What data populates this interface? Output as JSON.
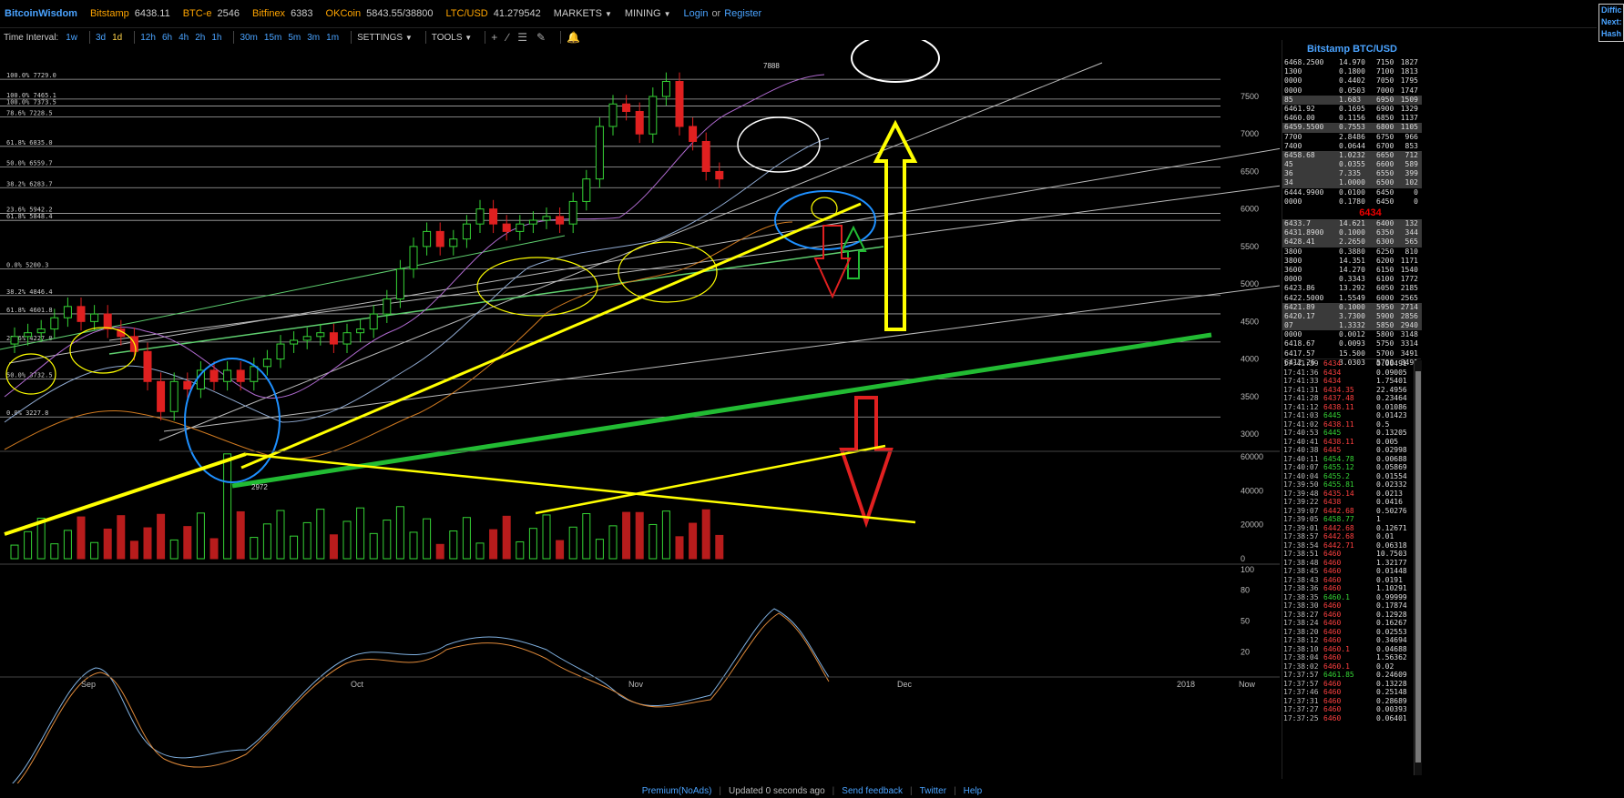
{
  "topbar": {
    "brand": "BitcoinWisdom",
    "tickers": [
      {
        "exchange": "Bitstamp",
        "price": "6438.11"
      },
      {
        "exchange": "BTC-e",
        "price": "2546"
      },
      {
        "exchange": "Bitfinex",
        "price": "6383"
      },
      {
        "exchange": "OKCoin",
        "price": "5843.55/38800"
      },
      {
        "exchange": "LTC/USD",
        "price": "41.279542"
      }
    ],
    "markets_label": "MARKETS",
    "mining_label": "MINING",
    "login_label": "Login",
    "or_label": "or",
    "register_label": "Register",
    "difficulty": [
      "Diffic",
      "Next:",
      "Hash"
    ]
  },
  "toolbar": {
    "time_interval_label": "Time Interval:",
    "intervals": [
      "1w",
      "3d",
      "1d",
      "12h",
      "6h",
      "4h",
      "2h",
      "1h",
      "30m",
      "15m",
      "5m",
      "3m",
      "1m"
    ],
    "settings_label": "SETTINGS",
    "tools_label": "TOOLS"
  },
  "chart_data": {
    "type": "candlestick",
    "series_summary": "BTC/USD daily candles, Sep–Nov 2017",
    "x_ticks": [
      "Sep",
      "Oct",
      "Nov",
      "Dec",
      "2018",
      "Now"
    ],
    "price_axis": [
      3000,
      3500,
      4000,
      4500,
      5000,
      5500,
      6000,
      6500,
      7000,
      7500
    ],
    "volume_axis": [
      0,
      20000,
      40000,
      60000
    ],
    "stoch_axis": [
      20,
      50,
      80,
      100
    ],
    "fib_levels": [
      "100.0% 7729.0",
      "100.0% 7465.1",
      "100.0% 7373.5",
      "78.6% 7228.5",
      "61.8% 6835.0",
      "50.0% 6559.7",
      "38.2% 6283.7",
      "23.6% 5942.2",
      "61.8% 5848.4",
      "0.0% 5200.3",
      "38.2% 4846.4",
      "61.8% 4601.8",
      "23.6% 4227.0",
      "50.0% 3732.5",
      "0.0% 3227.8"
    ],
    "annotations": [
      "7888",
      "2972"
    ],
    "closes": [
      4300,
      4350,
      4400,
      4550,
      4700,
      4500,
      4600,
      4400,
      4300,
      4100,
      3700,
      3300,
      3700,
      3600,
      3850,
      3700,
      3850,
      3700,
      3900,
      4000,
      4200,
      4250,
      4300,
      4350,
      4200,
      4350,
      4400,
      4600,
      4800,
      5200,
      5500,
      5700,
      5500,
      5600,
      5800,
      6000,
      5800,
      5700,
      5800,
      5850,
      5900,
      5800,
      6100,
      6400,
      7100,
      7400,
      7300,
      7000,
      7500,
      7700,
      7100,
      6900,
      6500,
      6400
    ]
  },
  "orderbook": {
    "title": "Bitstamp BTC/USD",
    "asks": [
      [
        "6468.2500",
        "14.970",
        "7150",
        "1827"
      ],
      [
        "1300",
        "0.1800",
        "7100",
        "1813"
      ],
      [
        "0000",
        "0.4402",
        "7050",
        "1795"
      ],
      [
        "0000",
        "0.0503",
        "7000",
        "1747"
      ],
      [
        "85",
        "1.683",
        "6950",
        "1509"
      ],
      [
        "6461.92",
        "0.1695",
        "6900",
        "1329"
      ],
      [
        "6460.00",
        "0.1156",
        "6850",
        "1137"
      ],
      [
        "6459.5500",
        "0.7553",
        "6800",
        "1105"
      ],
      [
        "7700",
        "2.8486",
        "6750",
        "966"
      ],
      [
        "7400",
        "0.0644",
        "6700",
        "853"
      ],
      [
        "6458.68",
        "1.0232",
        "6650",
        "712"
      ],
      [
        "45",
        "0.0355",
        "6600",
        "589"
      ],
      [
        "36",
        "7.335",
        "6550",
        "399"
      ],
      [
        "34",
        "1.0000",
        "6500",
        "102"
      ],
      [
        "6444.9900",
        "0.0100",
        "6450",
        "0"
      ],
      [
        "0000",
        "0.1780",
        "6450",
        "0"
      ]
    ],
    "last_price": "6434",
    "bids": [
      [
        "6433.7",
        "14.621",
        "6400",
        "132"
      ],
      [
        "6431.8900",
        "0.1000",
        "6350",
        "344"
      ],
      [
        "6428.41",
        "2.2650",
        "6300",
        "565"
      ],
      [
        "3800",
        "0.3880",
        "6250",
        "810"
      ],
      [
        "3800",
        "14.351",
        "6200",
        "1171"
      ],
      [
        "3600",
        "14.270",
        "6150",
        "1540"
      ],
      [
        "0000",
        "0.3343",
        "6100",
        "1772"
      ],
      [
        "6423.86",
        "13.292",
        "6050",
        "2185"
      ],
      [
        "6422.5000",
        "1.5549",
        "6000",
        "2565"
      ],
      [
        "6421.89",
        "0.1000",
        "5950",
        "2714"
      ],
      [
        "6420.17",
        "3.7300",
        "5900",
        "2856"
      ],
      [
        "07",
        "1.3332",
        "5850",
        "2940"
      ],
      [
        "0000",
        "0.0012",
        "5800",
        "3148"
      ],
      [
        "6418.67",
        "0.0093",
        "5750",
        "3314"
      ],
      [
        "6417.57",
        "15.500",
        "5700",
        "3491"
      ],
      [
        "6412.26",
        "3.0303",
        "5700",
        "3491"
      ]
    ]
  },
  "trades": [
    [
      "17:41:39",
      "6434",
      "0.00491",
      "down"
    ],
    [
      "17:41:36",
      "6434",
      "0.09005",
      "down"
    ],
    [
      "17:41:33",
      "6434",
      "1.75401",
      "down"
    ],
    [
      "17:41:31",
      "6434.35",
      "22.4956",
      "down"
    ],
    [
      "17:41:28",
      "6437.48",
      "0.23464",
      "down"
    ],
    [
      "17:41:12",
      "6438.11",
      "0.01086",
      "down"
    ],
    [
      "17:41:03",
      "6445",
      "0.01423",
      "up"
    ],
    [
      "17:41:02",
      "6438.11",
      "0.5",
      "down"
    ],
    [
      "17:40:53",
      "6445",
      "0.13205",
      "up"
    ],
    [
      "17:40:41",
      "6438.11",
      "0.005",
      "down"
    ],
    [
      "17:40:38",
      "6445",
      "0.02998",
      "down"
    ],
    [
      "17:40:11",
      "6454.78",
      "0.00688",
      "up"
    ],
    [
      "17:40:07",
      "6455.12",
      "0.05869",
      "up"
    ],
    [
      "17:40:04",
      "6455.2",
      "0.01554",
      "up"
    ],
    [
      "17:39:50",
      "6455.81",
      "0.02332",
      "up"
    ],
    [
      "17:39:48",
      "6435.14",
      "0.0213",
      "down"
    ],
    [
      "17:39:22",
      "6438",
      "0.0416",
      "down"
    ],
    [
      "17:39:07",
      "6442.68",
      "0.50276",
      "down"
    ],
    [
      "17:39:05",
      "6458.77",
      "1",
      "up"
    ],
    [
      "17:39:01",
      "6442.68",
      "0.12671",
      "down"
    ],
    [
      "17:38:57",
      "6442.68",
      "0.01",
      "down"
    ],
    [
      "17:38:54",
      "6442.71",
      "0.06318",
      "down"
    ],
    [
      "17:38:51",
      "6460",
      "10.7503",
      "down"
    ],
    [
      "17:38:48",
      "6460",
      "1.32177",
      "down"
    ],
    [
      "17:38:45",
      "6460",
      "0.01448",
      "down"
    ],
    [
      "17:38:43",
      "6460",
      "0.0191",
      "down"
    ],
    [
      "17:38:36",
      "6460",
      "1.10291",
      "down"
    ],
    [
      "17:38:35",
      "6460.1",
      "0.99999",
      "up"
    ],
    [
      "17:38:30",
      "6460",
      "0.17874",
      "down"
    ],
    [
      "17:38:27",
      "6460",
      "0.12928",
      "down"
    ],
    [
      "17:38:24",
      "6460",
      "0.16267",
      "down"
    ],
    [
      "17:38:20",
      "6460",
      "0.02553",
      "down"
    ],
    [
      "17:38:12",
      "6460",
      "0.34694",
      "down"
    ],
    [
      "17:38:10",
      "6460.1",
      "0.04688",
      "down"
    ],
    [
      "17:38:04",
      "6460",
      "1.56362",
      "down"
    ],
    [
      "17:38:02",
      "6460.1",
      "0.02",
      "down"
    ],
    [
      "17:37:57",
      "6461.85",
      "0.24609",
      "up"
    ],
    [
      "17:37:57",
      "6460",
      "0.13228",
      "down"
    ],
    [
      "17:37:46",
      "6460",
      "0.25148",
      "down"
    ],
    [
      "17:37:31",
      "6460",
      "0.28689",
      "down"
    ],
    [
      "17:37:27",
      "6460",
      "0.00393",
      "down"
    ],
    [
      "17:37:25",
      "6460",
      "0.06401",
      "down"
    ]
  ],
  "footer": {
    "premium_label": "Premium(NoAds)",
    "updated_label": "Updated 0 seconds ago",
    "feedback_label": "Send feedback",
    "twitter_label": "Twitter",
    "help_label": "Help"
  },
  "colors": {
    "accent": "#4aa3ff",
    "exchange": "#ffa500",
    "up": "#35d435",
    "down": "#e02020",
    "annot_yellow": "#ffff00",
    "annot_green": "#22bb33",
    "annot_blue": "#1e90ff"
  }
}
